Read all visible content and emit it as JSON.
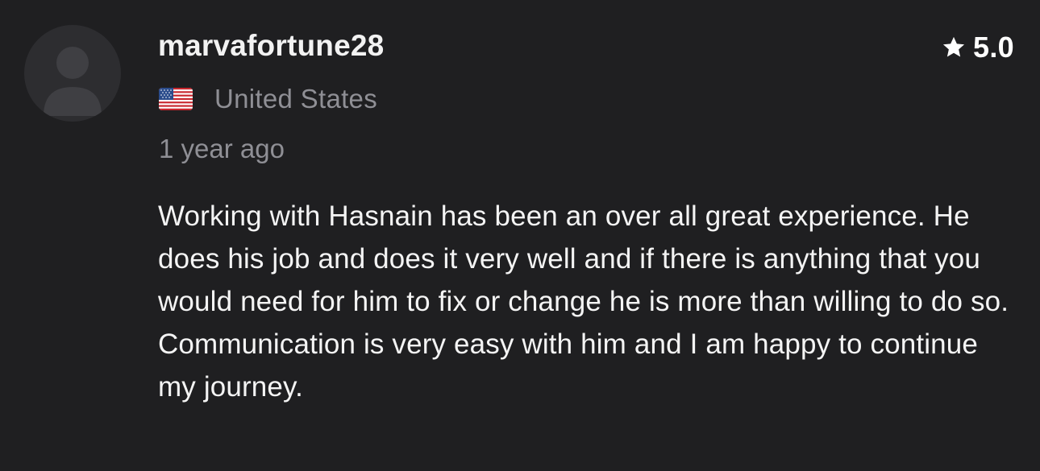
{
  "review": {
    "username": "marvafortune28",
    "avatar_icon": "user-silhouette-icon",
    "rating_icon": "star-icon",
    "rating": "5.0",
    "flag_icon": "us-flag-icon",
    "country": "United States",
    "time_ago": "1 year ago",
    "text": "Working with Hasnain has been an over all great experience. He does his job and does it very well and if there is anything that you would need for him to fix or change he is more than willing to do so. Communication is very easy with him and I am happy to continue my journey."
  },
  "colors": {
    "background": "#1f1f21",
    "avatar_bg": "#2d2d30",
    "avatar_figure": "#3f3f43",
    "primary_text": "#f2f2f2",
    "secondary_text": "#8f8f95"
  }
}
